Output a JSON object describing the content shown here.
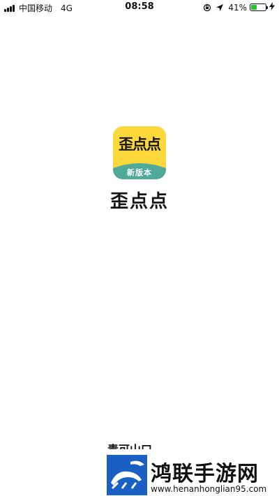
{
  "status_bar": {
    "carrier": "中国移动",
    "network": "4G",
    "time": "08:58",
    "battery_percent": "41%",
    "battery_level": 0.41,
    "battery_color": "#2bc12b"
  },
  "splash": {
    "icon_title": "歪点点",
    "icon_badge": "新版本",
    "app_name": "歪点点",
    "icon_bg_color": "#fdd83a",
    "badge_color": "#4faa9a"
  },
  "watermark": {
    "partial_text": "青可山口",
    "title": "鸿联手游网",
    "url": "www.henanhonglian95.com",
    "logo_color": "#1a5fc4"
  }
}
